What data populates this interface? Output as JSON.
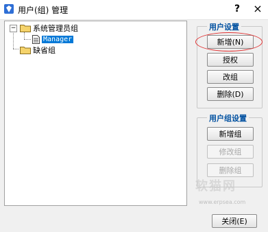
{
  "window": {
    "title": "用户(组) 管理",
    "help_label": "?",
    "close_label": "×"
  },
  "tree": {
    "nodes": [
      {
        "label": "系统管理员组",
        "toggle": "−"
      },
      {
        "label": "Manager"
      },
      {
        "label": "缺省组",
        "toggle": "+"
      }
    ]
  },
  "user_settings": {
    "title": "用户设置",
    "buttons": [
      "新增(N)",
      "授权",
      "改组",
      "删除(D)"
    ]
  },
  "group_settings": {
    "title": "用户组设置",
    "buttons": [
      "新增组",
      "修改组",
      "删除组"
    ]
  },
  "close_button": "关闭(E)",
  "watermark": {
    "logo": "软猫网",
    "url": "www.erpsea.com"
  }
}
